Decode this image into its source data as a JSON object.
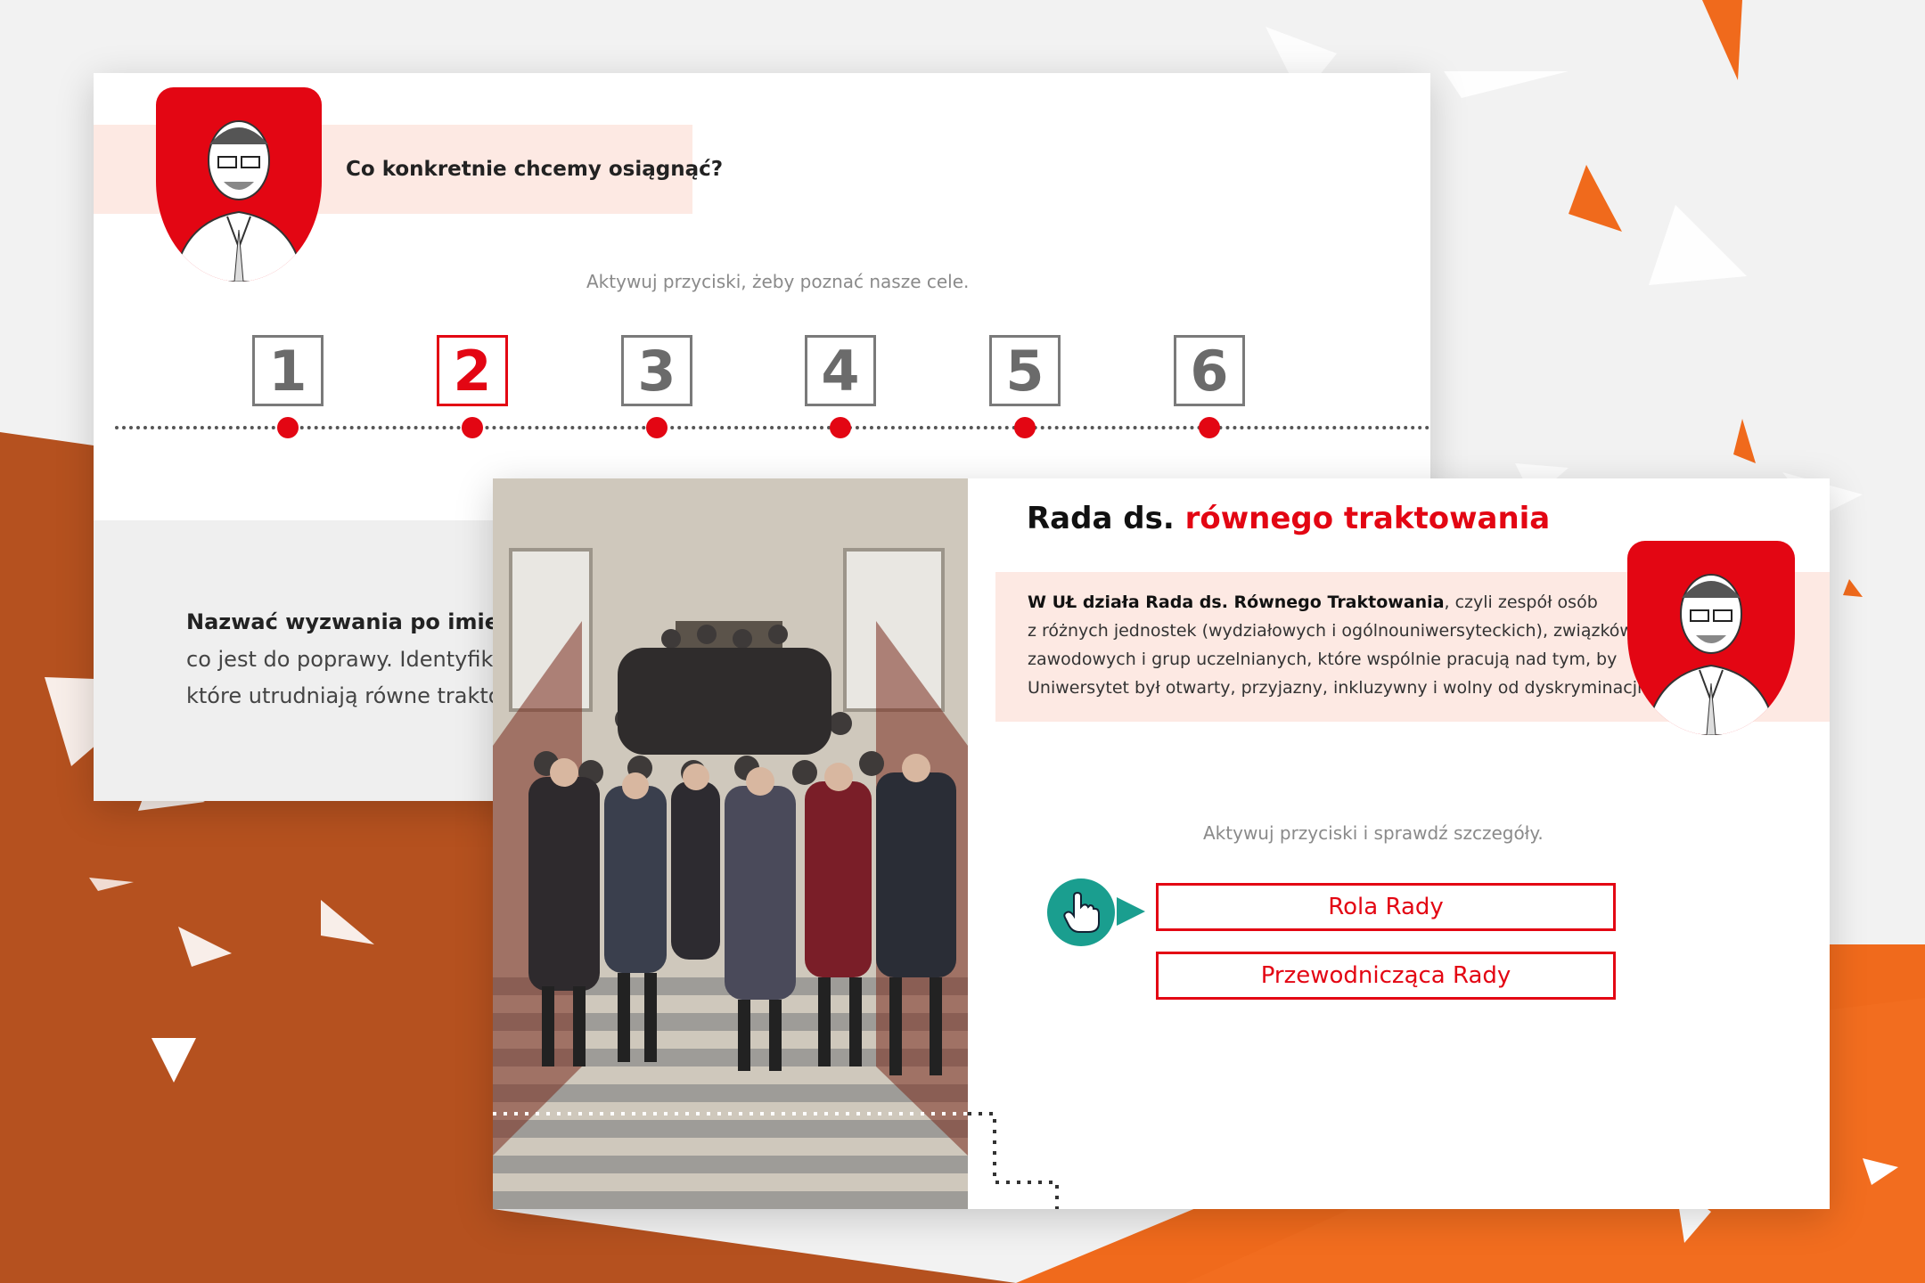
{
  "background": {
    "colors": {
      "rust": "#b5511f",
      "orange": "#f06a1c",
      "light": "#f2f2f2"
    }
  },
  "back_slide": {
    "question": "Co konkretnie chcemy osiągnąć?",
    "hint": "Aktywuj przyciski, żeby poznać nasze cele.",
    "numbers": [
      "1",
      "2",
      "3",
      "4",
      "5",
      "6"
    ],
    "active_number": "2",
    "lines": [
      "Nazwać wyzwania po imieniu,",
      "co jest do poprawy. Identyfikuje",
      "które utrudniają równe traktow"
    ],
    "avatar_icon": "portrait-illustration-icon"
  },
  "front_slide": {
    "title_plain": "Rada ds.",
    "title_accent": "równego traktowania",
    "desc_bold": "W UŁ działa Rada ds. Równego Traktowania",
    "desc_line1_rest": ", czyli zespół osób",
    "desc_line2": "z różnych jednostek (wydziałowych i ogólnouniwersyteckich), związków",
    "desc_line3": "zawodowych i grup uczelnianych, które wspólnie pracują nad tym, by",
    "desc_line4": "Uniwersytet był otwarty, przyjazny, inkluzywny i wolny od dyskryminacji.",
    "hint": "Aktywuj przyciski i sprawdź szczegóły.",
    "buttons": [
      "Rola Rady",
      "Przewodnicząca Rady"
    ],
    "accent_color": "#e30613",
    "pointer_icon": "hand-pointer-icon",
    "photo_icon": "group-photo-icon"
  }
}
